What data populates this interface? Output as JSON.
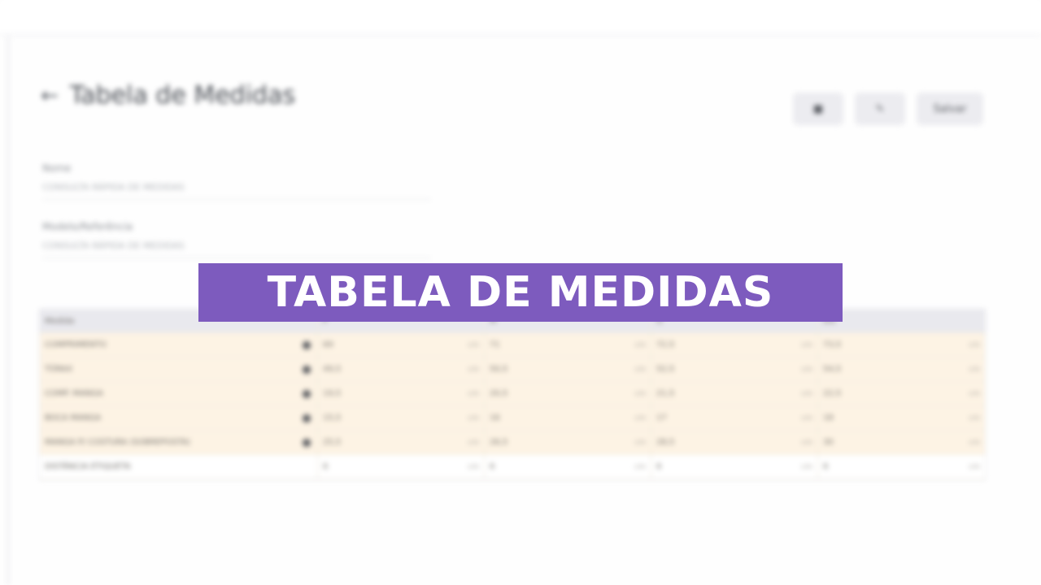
{
  "page": {
    "title": "Tabela de Medidas",
    "back_icon": "arrow-left-icon"
  },
  "actions": [
    {
      "kind": "icon",
      "icon": "trash-icon",
      "glyph": "■"
    },
    {
      "kind": "icon",
      "icon": "edit-icon",
      "glyph": "✎"
    },
    {
      "kind": "text",
      "label": "Salvar"
    }
  ],
  "fields": [
    {
      "label": "Nome",
      "value": "CONSULTA RÁPIDA DE MEDIDAS"
    },
    {
      "label": "Modelo/Referência",
      "value": "CONSULTA RÁPIDA DE MEDIDAS"
    }
  ],
  "table": {
    "headers": [
      "Medida",
      "P",
      "M",
      "G",
      "GG"
    ],
    "unit": "cm",
    "rows": [
      {
        "name": "COMPRIMENTO",
        "values": [
          "69",
          "71",
          "72,5",
          "73,5"
        ],
        "style": "filled",
        "marked": true
      },
      {
        "name": "TÓRAX",
        "values": [
          "49,5",
          "50,5",
          "52,5",
          "54,5"
        ],
        "style": "filled",
        "marked": true
      },
      {
        "name": "COMP. MANGA",
        "values": [
          "19,5",
          "20,5",
          "21,5",
          "22,5"
        ],
        "style": "filled",
        "marked": true
      },
      {
        "name": "BOCA MANGA",
        "values": [
          "15,5",
          "16",
          "17",
          "18"
        ],
        "style": "filled",
        "marked": true
      },
      {
        "name": "MANGA P/ COSTURA (SOBREPOSTA)",
        "values": [
          "25,5",
          "26,5",
          "28,5",
          "30"
        ],
        "style": "filled",
        "marked": true
      },
      {
        "name": "DISTÂNCIA ETIQUETA",
        "values": [
          "6",
          "6",
          "6",
          "6"
        ],
        "style": "plain",
        "marked": false
      }
    ]
  },
  "overlay": {
    "text": "TABELA DE MEDIDAS",
    "color": "#7d5bbe"
  }
}
